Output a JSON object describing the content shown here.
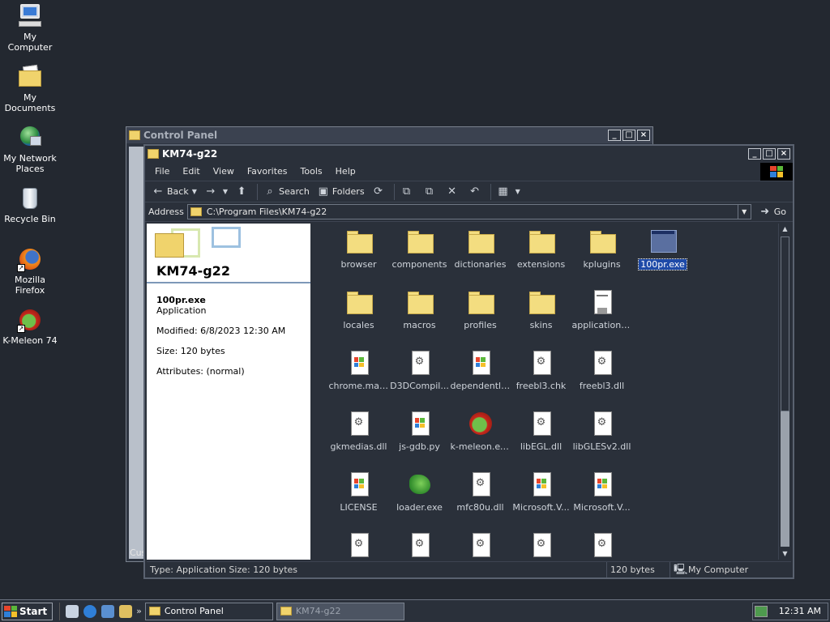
{
  "desktop": {
    "icons": [
      {
        "label": "My Computer"
      },
      {
        "label": "My Documents"
      },
      {
        "label": "My Network Places"
      },
      {
        "label": "Recycle Bin"
      },
      {
        "label": "Mozilla Firefox"
      },
      {
        "label": "K-Meleon 74"
      }
    ]
  },
  "control_panel": {
    "title": "Control Panel",
    "status_fragment": "Cus"
  },
  "explorer": {
    "title": "KM74-g22",
    "menu": [
      "File",
      "Edit",
      "View",
      "Favorites",
      "Tools",
      "Help"
    ],
    "toolbar": {
      "back": "Back",
      "search": "Search",
      "folders": "Folders"
    },
    "address": {
      "label": "Address",
      "value": "C:\\Program Files\\KM74-g22",
      "go": "Go"
    },
    "details": {
      "folder_name": "KM74-g22",
      "file_name": "100pr.exe",
      "file_type": "Application",
      "modified": "Modified: 6/8/2023 12:30 AM",
      "size": "Size: 120 bytes",
      "attributes": "Attributes: (normal)"
    },
    "items": [
      {
        "label": "browser",
        "icon": "folder"
      },
      {
        "label": "components",
        "icon": "folder"
      },
      {
        "label": "dictionaries",
        "icon": "folder"
      },
      {
        "label": "extensions",
        "icon": "folder"
      },
      {
        "label": "kplugins",
        "icon": "folder"
      },
      {
        "label": "100pr.exe",
        "icon": "exe-window",
        "selected": true
      },
      {
        "label": "locales",
        "icon": "folder"
      },
      {
        "label": "macros",
        "icon": "folder"
      },
      {
        "label": "profiles",
        "icon": "folder"
      },
      {
        "label": "skins",
        "icon": "folder"
      },
      {
        "label": "application.ini",
        "icon": "ini"
      },
      {
        "label": "",
        "icon": "none"
      },
      {
        "label": "chrome.man...",
        "icon": "flag-file"
      },
      {
        "label": "D3DCompil...",
        "icon": "gear-file"
      },
      {
        "label": "dependentli...",
        "icon": "flag-file"
      },
      {
        "label": "freebl3.chk",
        "icon": "gear-file"
      },
      {
        "label": "freebl3.dll",
        "icon": "gear-file"
      },
      {
        "label": "",
        "icon": "none"
      },
      {
        "label": "gkmedias.dll",
        "icon": "gear-file"
      },
      {
        "label": "js-gdb.py",
        "icon": "flag-file"
      },
      {
        "label": "k-meleon.exe",
        "icon": "kmeleon"
      },
      {
        "label": "libEGL.dll",
        "icon": "gear-file"
      },
      {
        "label": "libGLESv2.dll",
        "icon": "gear-file"
      },
      {
        "label": "",
        "icon": "none"
      },
      {
        "label": "LICENSE",
        "icon": "flag-file"
      },
      {
        "label": "loader.exe",
        "icon": "loader"
      },
      {
        "label": "mfc80u.dll",
        "icon": "gear-file"
      },
      {
        "label": "Microsoft.V...",
        "icon": "flag-file"
      },
      {
        "label": "Microsoft.V...",
        "icon": "flag-file"
      },
      {
        "label": "",
        "icon": "none"
      },
      {
        "label": "",
        "icon": "gear-file"
      },
      {
        "label": "",
        "icon": "gear-file"
      },
      {
        "label": "",
        "icon": "gear-file"
      },
      {
        "label": "",
        "icon": "gear-file"
      },
      {
        "label": "",
        "icon": "gear-file"
      }
    ],
    "status": {
      "left": "Type: Application Size: 120 bytes",
      "size": "120 bytes",
      "zone": "My Computer"
    }
  },
  "taskbar": {
    "start": "Start",
    "tasks": [
      {
        "label": "Control Panel",
        "active": false
      },
      {
        "label": "KM74-g22",
        "active": true
      }
    ],
    "clock": "12:31 AM"
  }
}
